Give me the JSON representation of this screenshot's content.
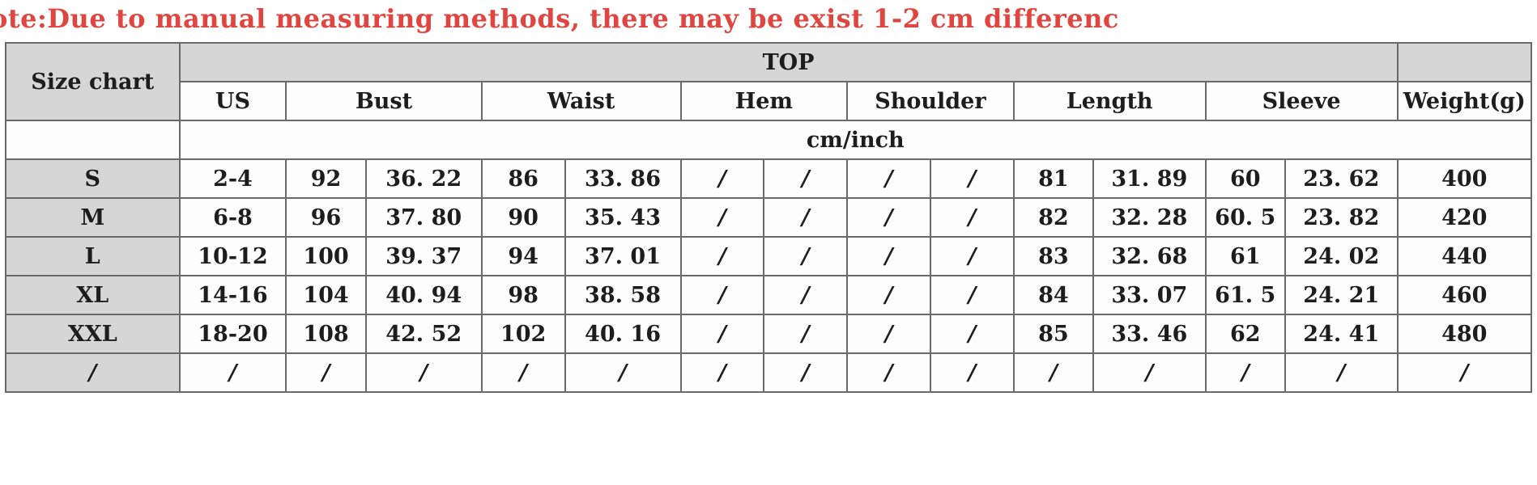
{
  "note": {
    "text": "ote:Due to manual measuring methods, there may be exist 1-2 cm differenc",
    "color": "#e0453f"
  },
  "table": {
    "corner_label": "Size chart",
    "group_label": "TOP",
    "weight_label": "Weight(g)",
    "unit_label": "cm/inch",
    "measure_headers": [
      "US",
      "Bust",
      "Waist",
      "Hem",
      "Shoulder",
      "Length",
      "Sleeve"
    ],
    "columns": [
      "Size chart",
      "US",
      "Bust cm",
      "Bust inch",
      "Waist cm",
      "Waist inch",
      "Hem cm",
      "Hem inch",
      "Shoulder cm",
      "Shoulder inch",
      "Length cm",
      "Length inch",
      "Sleeve cm",
      "Sleeve inch",
      "Weight(g)"
    ],
    "rows": [
      {
        "size": "S",
        "us": "2-4",
        "bust_cm": "92",
        "bust_in": "36. 22",
        "waist_cm": "86",
        "waist_in": "33. 86",
        "hem_cm": "/",
        "hem_in": "/",
        "shoulder_cm": "/",
        "shoulder_in": "/",
        "length_cm": "81",
        "length_in": "31. 89",
        "sleeve_cm": "60",
        "sleeve_in": "23. 62",
        "weight": "400"
      },
      {
        "size": "M",
        "us": "6-8",
        "bust_cm": "96",
        "bust_in": "37. 80",
        "waist_cm": "90",
        "waist_in": "35. 43",
        "hem_cm": "/",
        "hem_in": "/",
        "shoulder_cm": "/",
        "shoulder_in": "/",
        "length_cm": "82",
        "length_in": "32. 28",
        "sleeve_cm": "60. 5",
        "sleeve_in": "23. 82",
        "weight": "420"
      },
      {
        "size": "L",
        "us": "10-12",
        "bust_cm": "100",
        "bust_in": "39. 37",
        "waist_cm": "94",
        "waist_in": "37. 01",
        "hem_cm": "/",
        "hem_in": "/",
        "shoulder_cm": "/",
        "shoulder_in": "/",
        "length_cm": "83",
        "length_in": "32. 68",
        "sleeve_cm": "61",
        "sleeve_in": "24. 02",
        "weight": "440"
      },
      {
        "size": "XL",
        "us": "14-16",
        "bust_cm": "104",
        "bust_in": "40. 94",
        "waist_cm": "98",
        "waist_in": "38. 58",
        "hem_cm": "/",
        "hem_in": "/",
        "shoulder_cm": "/",
        "shoulder_in": "/",
        "length_cm": "84",
        "length_in": "33. 07",
        "sleeve_cm": "61. 5",
        "sleeve_in": "24. 21",
        "weight": "460"
      },
      {
        "size": "XXL",
        "us": "18-20",
        "bust_cm": "108",
        "bust_in": "42. 52",
        "waist_cm": "102",
        "waist_in": "40. 16",
        "hem_cm": "/",
        "hem_in": "/",
        "shoulder_cm": "/",
        "shoulder_in": "/",
        "length_cm": "85",
        "length_in": "33. 46",
        "sleeve_cm": "62",
        "sleeve_in": "24. 41",
        "weight": "480"
      },
      {
        "size": "/",
        "us": "/",
        "bust_cm": "/",
        "bust_in": "/",
        "waist_cm": "/",
        "waist_in": "/",
        "hem_cm": "/",
        "hem_in": "/",
        "shoulder_cm": "/",
        "shoulder_in": "/",
        "length_cm": "/",
        "length_in": "/",
        "sleeve_cm": "/",
        "sleeve_in": "/",
        "weight": "/"
      }
    ]
  },
  "colors": {
    "header_shade": "#d6d6d6",
    "cell_bg": "#fdfdfd",
    "border": "#6a6a6a",
    "text": "#1d1d1d",
    "note_red": "#e0453f"
  }
}
